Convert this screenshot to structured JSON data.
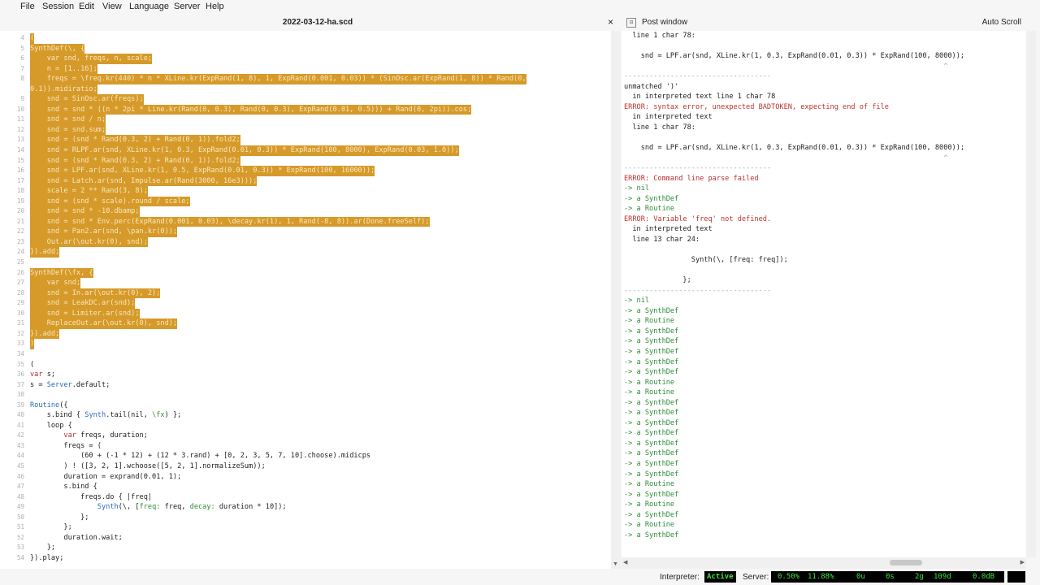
{
  "menu": [
    "File",
    "Session",
    "Edit",
    "View",
    "Language",
    "Server",
    "Help"
  ],
  "editor": {
    "title": "2022-03-12-ha.scd",
    "close": "×",
    "lines": [
      {
        "n": "4",
        "hl": true,
        "t": "("
      },
      {
        "n": "5",
        "hl": true,
        "t": "SynthDef(\\, {"
      },
      {
        "n": "6",
        "hl": true,
        "t": "    var snd, freqs, n, scale;"
      },
      {
        "n": "7",
        "hl": true,
        "t": "    n = [1..16];"
      },
      {
        "n": "8",
        "hl": true,
        "t": "    freqs = \\freq.kr(440) * n * XLine.kr(ExpRand(1, 8), 1, ExpRand(0.001, 0.03)) * (SinOsc.ar(ExpRand(1, 8)) * Rand(0,"
      },
      {
        "n": "",
        "hl": true,
        "t": "0.1)).midiratio;"
      },
      {
        "n": "9",
        "hl": true,
        "t": "    snd = SinOsc.ar(freqs);"
      },
      {
        "n": "10",
        "hl": true,
        "t": "    snd = snd * ((n * 2pi * Line.kr(Rand(0, 0.3), Rand(0, 0.3), ExpRand(0.01, 0.5))) + Rand(0, 2pi)).cos;"
      },
      {
        "n": "11",
        "hl": true,
        "t": "    snd = snd / n;"
      },
      {
        "n": "12",
        "hl": true,
        "t": "    snd = snd.sum;"
      },
      {
        "n": "13",
        "hl": true,
        "t": "    snd = (snd * Rand(0.3, 2) + Rand(0, 1)).fold2;"
      },
      {
        "n": "14",
        "hl": true,
        "t": "    snd = RLPF.ar(snd, XLine.kr(1, 0.3, ExpRand(0.01, 0.3)) * ExpRand(100, 8000), ExpRand(0.03, 1.0));"
      },
      {
        "n": "15",
        "hl": true,
        "t": "    snd = (snd * Rand(0.3, 2) + Rand(0, 1)).fold2;"
      },
      {
        "n": "16",
        "hl": true,
        "t": "    snd = LPF.ar(snd, XLine.kr(1, 0.5, ExpRand(0.01, 0.3)) * ExpRand(100, 16000));"
      },
      {
        "n": "17",
        "hl": true,
        "t": "    snd = Latch.ar(snd, Impulse.ar(Rand(3000, 16e3)));"
      },
      {
        "n": "18",
        "hl": true,
        "t": "    scale = 2 ** Rand(3, 8);"
      },
      {
        "n": "19",
        "hl": true,
        "t": "    snd = (snd * scale).round / scale;"
      },
      {
        "n": "20",
        "hl": true,
        "t": "    snd = snd * -10.dbamp;"
      },
      {
        "n": "21",
        "hl": true,
        "t": "    snd = snd * Env.perc(ExpRand(0.001, 0.03), \\decay.kr(1), 1, Rand(-8, 8)).ar(Done.freeSelf);"
      },
      {
        "n": "22",
        "hl": true,
        "t": "    snd = Pan2.ar(snd, \\pan.kr(0));"
      },
      {
        "n": "23",
        "hl": true,
        "t": "    Out.ar(\\out.kr(0), snd);"
      },
      {
        "n": "24",
        "hl": true,
        "t": "}).add;"
      },
      {
        "n": "25",
        "hl": false,
        "t": ""
      },
      {
        "n": "26",
        "hl": true,
        "t": "SynthDef(\\fx, {"
      },
      {
        "n": "27",
        "hl": true,
        "t": "    var snd;"
      },
      {
        "n": "28",
        "hl": true,
        "t": "    snd = In.ar(\\out.kr(0), 2);"
      },
      {
        "n": "29",
        "hl": true,
        "t": "    snd = LeakDC.ar(snd);"
      },
      {
        "n": "30",
        "hl": true,
        "t": "    snd = Limiter.ar(snd);"
      },
      {
        "n": "31",
        "hl": true,
        "t": "    ReplaceOut.ar(\\out.kr(0), snd);"
      },
      {
        "n": "32",
        "hl": true,
        "t": "}).add;"
      },
      {
        "n": "33",
        "hl": true,
        "t": ")"
      },
      {
        "n": "34",
        "hl": false,
        "t": ""
      },
      {
        "n": "35",
        "hl": false,
        "t": "("
      },
      {
        "n": "36",
        "hl": false,
        "t": "var s;"
      },
      {
        "n": "37",
        "hl": false,
        "t": "s = Server.default;"
      },
      {
        "n": "38",
        "hl": false,
        "t": ""
      },
      {
        "n": "39",
        "hl": false,
        "t": "Routine({"
      },
      {
        "n": "40",
        "hl": false,
        "t": "    s.bind { Synth.tail(nil, \\fx) };"
      },
      {
        "n": "41",
        "hl": false,
        "t": "    loop {"
      },
      {
        "n": "42",
        "hl": false,
        "t": "        var freqs, duration;"
      },
      {
        "n": "43",
        "hl": false,
        "t": "        freqs = ("
      },
      {
        "n": "44",
        "hl": false,
        "t": "            (60 + (-1 * 12) + (12 * 3.rand) + [0, 2, 3, 5, 7, 10].choose).midicps"
      },
      {
        "n": "45",
        "hl": false,
        "t": "        ) ! ([3, 2, 1].wchoose([5, 2, 1].normalizeSum));"
      },
      {
        "n": "46",
        "hl": false,
        "t": "        duration = exprand(0.01, 1);"
      },
      {
        "n": "47",
        "hl": false,
        "t": "        s.bind {"
      },
      {
        "n": "48",
        "hl": false,
        "t": "            freqs.do { |freq|"
      },
      {
        "n": "49",
        "hl": false,
        "t": "                Synth(\\, [freq: freq, decay: duration * 10]);"
      },
      {
        "n": "50",
        "hl": false,
        "t": "            };"
      },
      {
        "n": "51",
        "hl": false,
        "t": "        };"
      },
      {
        "n": "52",
        "hl": false,
        "t": "        duration.wait;"
      },
      {
        "n": "53",
        "hl": false,
        "t": "    };"
      },
      {
        "n": "54",
        "hl": false,
        "t": "}).play;"
      }
    ]
  },
  "post": {
    "title": "Post window",
    "auto_scroll": "Auto Scroll",
    "lines": [
      {
        "c": "normal",
        "t": "  line 1 char 78:"
      },
      {
        "c": "normal",
        "t": ""
      },
      {
        "c": "normal",
        "t": "    snd = LPF.ar(snd, XLine.kr(1, 0.3, ExpRand(0.01, 0.3)) * ExpRand(100, 8000));"
      },
      {
        "c": "sep",
        "t": "                                                                            ^"
      },
      {
        "c": "sep",
        "t": "-----------------------------------"
      },
      {
        "c": "normal",
        "t": "unmatched ')'"
      },
      {
        "c": "normal",
        "t": "  in interpreted text line 1 char 78"
      },
      {
        "c": "error",
        "t": "ERROR: syntax error, unexpected BADTOKEN, expecting end of file"
      },
      {
        "c": "normal",
        "t": "  in interpreted text"
      },
      {
        "c": "normal",
        "t": "  line 1 char 78:"
      },
      {
        "c": "normal",
        "t": ""
      },
      {
        "c": "normal",
        "t": "    snd = LPF.ar(snd, XLine.kr(1, 0.3, ExpRand(0.01, 0.3)) * ExpRand(100, 8000));"
      },
      {
        "c": "sep",
        "t": "                                                                            ^"
      },
      {
        "c": "sep",
        "t": "-----------------------------------"
      },
      {
        "c": "error",
        "t": "ERROR: Command line parse failed"
      },
      {
        "c": "green",
        "t": "-> nil"
      },
      {
        "c": "green",
        "t": "-> a SynthDef"
      },
      {
        "c": "green",
        "t": "-> a Routine"
      },
      {
        "c": "error",
        "t": "ERROR: Variable 'freq' not defined."
      },
      {
        "c": "normal",
        "t": "  in interpreted text"
      },
      {
        "c": "normal",
        "t": "  line 13 char 24:"
      },
      {
        "c": "normal",
        "t": ""
      },
      {
        "c": "normal",
        "t": "                Synth(\\, [freq: freq]);"
      },
      {
        "c": "normal",
        "t": ""
      },
      {
        "c": "normal",
        "t": "              };"
      },
      {
        "c": "sep",
        "t": "-----------------------------------"
      },
      {
        "c": "green",
        "t": "-> nil"
      },
      {
        "c": "green",
        "t": "-> a SynthDef"
      },
      {
        "c": "green",
        "t": "-> a Routine"
      },
      {
        "c": "green",
        "t": "-> a SynthDef"
      },
      {
        "c": "green",
        "t": "-> a SynthDef"
      },
      {
        "c": "green",
        "t": "-> a SynthDef"
      },
      {
        "c": "green",
        "t": "-> a SynthDef"
      },
      {
        "c": "green",
        "t": "-> a SynthDef"
      },
      {
        "c": "green",
        "t": "-> a Routine"
      },
      {
        "c": "green",
        "t": "-> a Routine"
      },
      {
        "c": "green",
        "t": "-> a SynthDef"
      },
      {
        "c": "green",
        "t": "-> a SynthDef"
      },
      {
        "c": "green",
        "t": "-> a SynthDef"
      },
      {
        "c": "green",
        "t": "-> a SynthDef"
      },
      {
        "c": "green",
        "t": "-> a SynthDef"
      },
      {
        "c": "green",
        "t": "-> a SynthDef"
      },
      {
        "c": "green",
        "t": "-> a SynthDef"
      },
      {
        "c": "green",
        "t": "-> a SynthDef"
      },
      {
        "c": "green",
        "t": "-> a Routine"
      },
      {
        "c": "green",
        "t": "-> a SynthDef"
      },
      {
        "c": "green",
        "t": "-> a Routine"
      },
      {
        "c": "green",
        "t": "-> a SynthDef"
      },
      {
        "c": "green",
        "t": "-> a Routine"
      },
      {
        "c": "green",
        "t": "-> a SynthDef"
      }
    ]
  },
  "status": {
    "interpreter_label": "Interpreter:",
    "interpreter_state": "Active",
    "server_label": "Server:",
    "avg_cpu": "0.50%",
    "peak_cpu": "11.88%",
    "ugens": "0u",
    "synths": "0s",
    "groups": "2g",
    "synthdefs": "109d",
    "volume": "0.0dB",
    "interpreter_color": "#39e639"
  }
}
